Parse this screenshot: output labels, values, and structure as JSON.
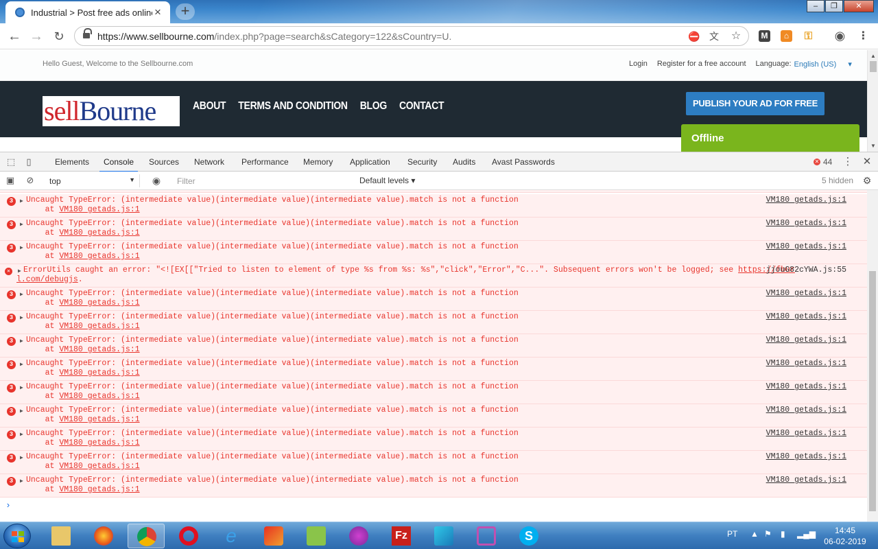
{
  "browser": {
    "tab_title": "Industrial > Post free ads online",
    "url_host": "https://www.sellbourne.com",
    "url_path": "/index.php?page=search&sCategory=122&sCountry=U."
  },
  "site": {
    "welcome": "Hello Guest, Welcome to the Sellbourne.com",
    "login": "Login",
    "register": "Register for a free account",
    "language_label": "Language:",
    "language_value": "English (US)",
    "logo_sell": "sell",
    "logo_bourne": "Bourne",
    "nav": [
      "ABOUT",
      "TERMS AND CONDITION",
      "BLOG",
      "CONTACT"
    ],
    "publish_button": "PUBLISH YOUR AD FOR FREE",
    "chat_status": "Offline"
  },
  "devtools": {
    "tabs": [
      "Elements",
      "Console",
      "Sources",
      "Network",
      "Performance",
      "Memory",
      "Application",
      "Security",
      "Audits",
      "Avast Passwords"
    ],
    "active_tab": "Console",
    "error_count": "44",
    "context": "top",
    "filter_placeholder": "Filter",
    "levels": "Default levels",
    "hidden_count": "5 hidden",
    "repeat_badge": "3",
    "type_error_msg": "Uncaught TypeError: (intermediate value)(intermediate value)(intermediate value).match is not a function",
    "stack_prefix": "    at ",
    "stack_link": "VM180 getads.js:1",
    "source_link": "VM180 getads.js:1",
    "fb_error_msg": "ErrorUtils caught an error: \"<![EX[[\"Tried to listen to element of type %s from %s: %s\",\"click\",\"Error\",\"C...\". Subsequent errors won't be logged; see ",
    "fb_link_a": "https://fbur",
    "fb_link_b": "l.com/debugjs",
    "fb_period": ".",
    "fb_source": "jjouG82cYWA.js:55"
  },
  "taskbar": {
    "language": "PT",
    "time": "14:45",
    "date": "06-02-2019"
  },
  "colors": {
    "header_bg": "#1f2a33",
    "publish_bg": "#2d7dc2",
    "offline_bg": "#7ab51d",
    "error_red": "#e8342c",
    "error_row_bg": "#fff0f0"
  }
}
